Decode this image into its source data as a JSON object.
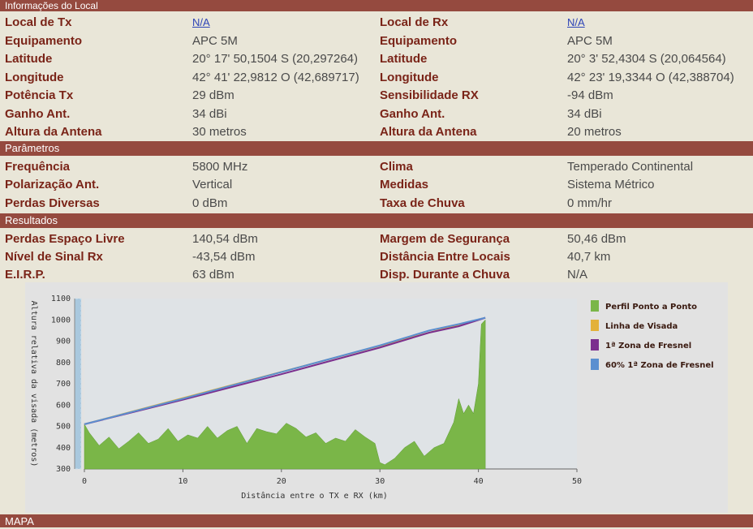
{
  "sections": {
    "local_info": "Informações do Local",
    "parameters": "Parâmetros",
    "results": "Resultados",
    "map": "MAPA"
  },
  "local": {
    "tx_label": "Local de Tx",
    "tx_value": "N/A",
    "rx_label": "Local de Rx",
    "rx_value": "N/A",
    "rows": [
      {
        "l1": "Equipamento",
        "v1": "APC 5M",
        "l2": "Equipamento",
        "v2": "APC 5M"
      },
      {
        "l1": "Latitude",
        "v1": "20° 17' 50,1504 S (20,297264)",
        "l2": "Latitude",
        "v2": "20° 3' 52,4304 S (20,064564)"
      },
      {
        "l1": "Longitude",
        "v1": "42° 41' 22,9812 O (42,689717)",
        "l2": "Longitude",
        "v2": "42° 23' 19,3344 O (42,388704)"
      },
      {
        "l1": "Potência Tx",
        "v1": "29 dBm",
        "l2": "Sensibilidade RX",
        "v2": "-94 dBm"
      },
      {
        "l1": "Ganho Ant.",
        "v1": "34 dBi",
        "l2": "Ganho Ant.",
        "v2": "34 dBi"
      },
      {
        "l1": "Altura da Antena",
        "v1": "30 metros",
        "l2": "Altura da Antena",
        "v2": "20 metros"
      }
    ]
  },
  "parameters": {
    "rows": [
      {
        "l1": "Frequência",
        "v1": "5800 MHz",
        "l2": "Clima",
        "v2": "Temperado Continental"
      },
      {
        "l1": "Polarização Ant.",
        "v1": "Vertical",
        "l2": "Medidas",
        "v2": "Sistema Métrico"
      },
      {
        "l1": "Perdas Diversas",
        "v1": "0 dBm",
        "l2": "Taxa de Chuva",
        "v2": "0 mm/hr"
      }
    ]
  },
  "results": {
    "rows": [
      {
        "l1": "Perdas Espaço Livre",
        "v1": "140,54 dBm",
        "l2": "Margem de Segurança",
        "v2": "50,46 dBm"
      },
      {
        "l1": "Nível de Sinal Rx",
        "v1": "-43,54 dBm",
        "l2": "Distância Entre Locais",
        "v2": "40,7 km"
      },
      {
        "l1": "E.I.R.P.",
        "v1": "63 dBm",
        "l2": "Disp. Durante a Chuva",
        "v2": "N/A"
      }
    ]
  },
  "chart_data": {
    "type": "area",
    "xlabel": "Distância entre o TX e RX (km)",
    "ylabel": "Altura relativa da visada (metros)",
    "xlim": [
      0,
      50
    ],
    "ylim": [
      300,
      1100
    ],
    "x_ticks": [
      0,
      10,
      20,
      30,
      40,
      50
    ],
    "y_ticks": [
      300,
      400,
      500,
      600,
      700,
      800,
      900,
      1000,
      1100
    ],
    "legend_position": "right",
    "series": [
      {
        "name": "Perfil Ponto a Ponto",
        "color": "#7ab648",
        "kind": "area",
        "x": [
          0,
          0.5,
          1.5,
          2.5,
          3.5,
          4.5,
          5.5,
          6.5,
          7.5,
          8.5,
          9.5,
          10.5,
          11.5,
          12.5,
          13.5,
          14.5,
          15.5,
          16.5,
          17.5,
          18.5,
          19.5,
          20.5,
          21.5,
          22.5,
          23.5,
          24.5,
          25.5,
          26.5,
          27.5,
          28.5,
          29.5,
          30,
          30.5,
          31.5,
          32.5,
          33.5,
          34.5,
          35.5,
          36.5,
          37.5,
          38,
          38.5,
          39,
          39.5,
          40,
          40.3,
          40.7
        ],
        "y": [
          510,
          470,
          410,
          450,
          395,
          430,
          470,
          420,
          440,
          490,
          430,
          460,
          445,
          500,
          445,
          480,
          500,
          420,
          490,
          475,
          465,
          515,
          490,
          450,
          470,
          420,
          445,
          430,
          485,
          450,
          420,
          330,
          320,
          350,
          400,
          430,
          360,
          400,
          420,
          520,
          630,
          560,
          600,
          560,
          700,
          980,
          1000
        ]
      },
      {
        "name": "Linha de Visada",
        "color": "#e3b13a",
        "kind": "line",
        "x": [
          0,
          40.7
        ],
        "y": [
          510,
          1010
        ]
      },
      {
        "name": "1ª Zona de Fresnel",
        "color": "#7b2f8e",
        "kind": "line",
        "x": [
          0,
          10,
          20,
          30,
          35,
          38,
          40.7
        ],
        "y": [
          510,
          625,
          745,
          870,
          940,
          970,
          1010
        ]
      },
      {
        "name": "60% 1ª Zona de Fresnel",
        "color": "#5b8fd0",
        "kind": "line",
        "x": [
          0,
          10,
          20,
          30,
          35,
          38,
          40.7
        ],
        "y": [
          510,
          630,
          755,
          880,
          950,
          980,
          1010
        ]
      }
    ]
  }
}
